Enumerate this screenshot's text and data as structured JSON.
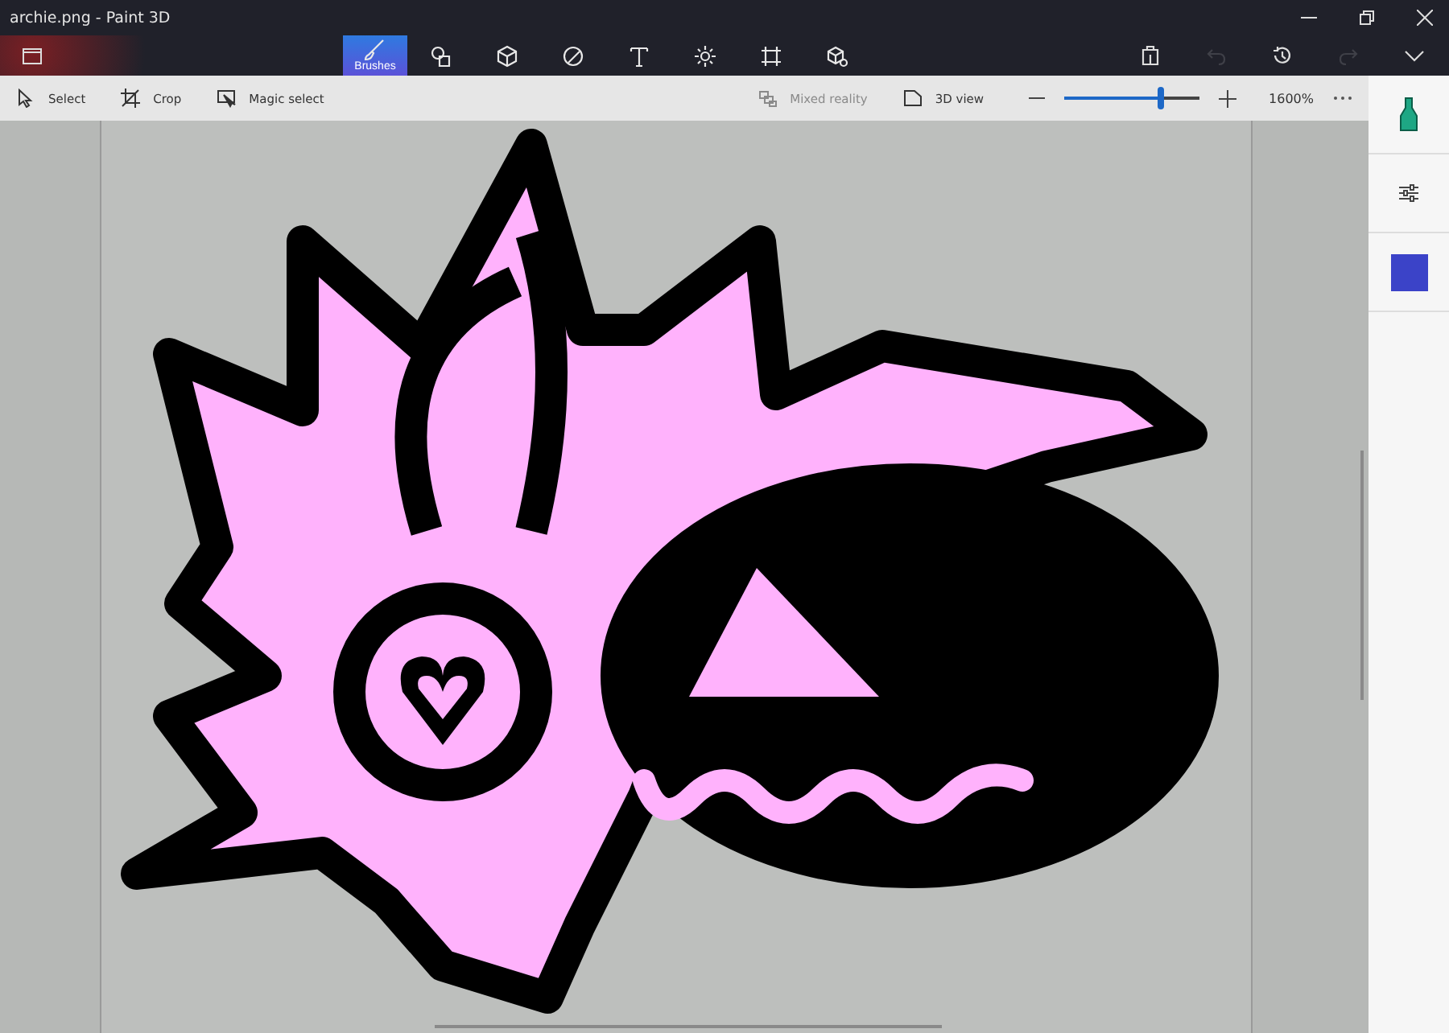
{
  "window": {
    "title": "archie.png - Paint 3D"
  },
  "main_tabs": [
    {
      "kind": "brushes",
      "label": "Brushes",
      "selected": true
    },
    {
      "kind": "shapes2d",
      "selected": false
    },
    {
      "kind": "shapes3d",
      "selected": false
    },
    {
      "kind": "stickers",
      "selected": false
    },
    {
      "kind": "text",
      "selected": false
    },
    {
      "kind": "effects",
      "selected": false
    },
    {
      "kind": "canvas",
      "selected": false
    },
    {
      "kind": "library",
      "selected": false
    }
  ],
  "actions": [
    {
      "kind": "paste",
      "disabled": false
    },
    {
      "kind": "undo",
      "disabled": true
    },
    {
      "kind": "history",
      "disabled": false
    },
    {
      "kind": "redo",
      "disabled": true
    },
    {
      "kind": "expand",
      "disabled": false
    }
  ],
  "tools": [
    {
      "kind": "select",
      "label": "Select",
      "disabled": false
    },
    {
      "kind": "crop",
      "label": "Crop",
      "disabled": false
    },
    {
      "kind": "magic",
      "label": "Magic select",
      "disabled": false
    }
  ],
  "view_tools": [
    {
      "kind": "mixed",
      "label": "Mixed reality",
      "disabled": true
    },
    {
      "kind": "view3d",
      "label": "3D view",
      "disabled": false
    }
  ],
  "zoom": {
    "level": 0.71,
    "reading": "1600%"
  }
}
